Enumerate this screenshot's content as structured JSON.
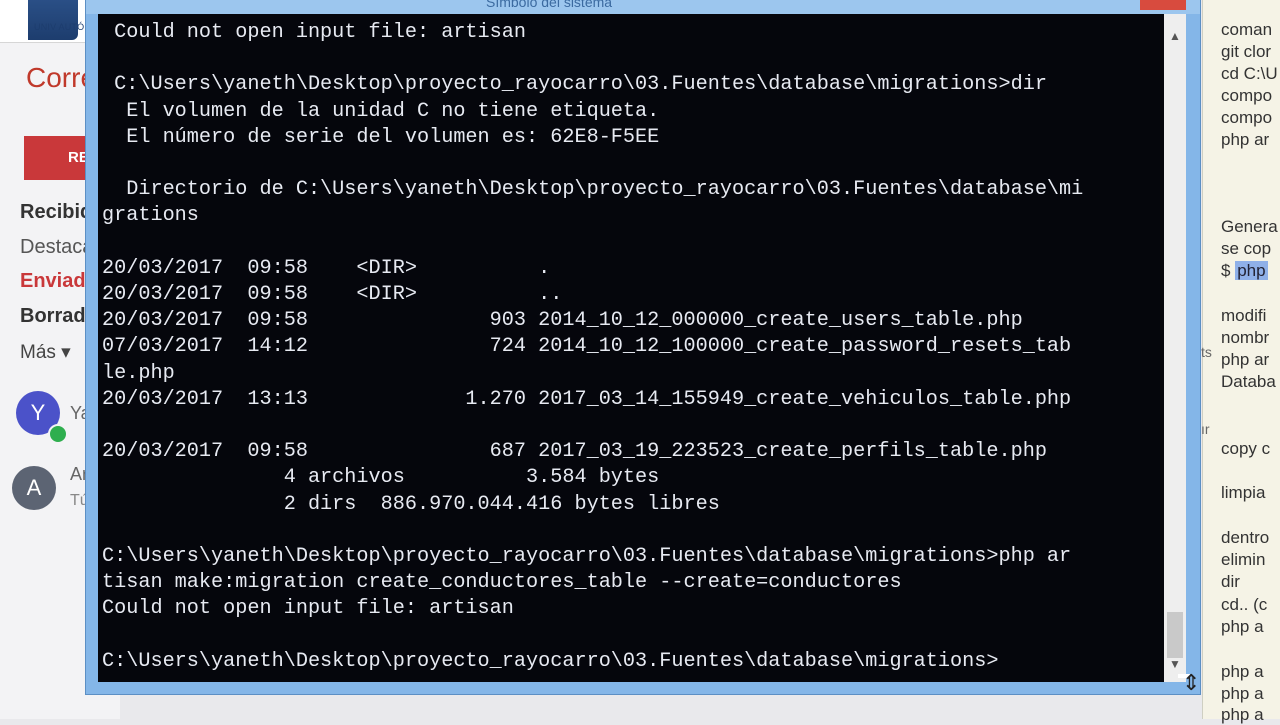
{
  "email_app": {
    "logo_text": "UNIV AUTÓNOMA",
    "title": "Correo",
    "compose": "RED",
    "folders": [
      "Recibid",
      "Destaca",
      "Enviado",
      "Borrado",
      "Más ▾"
    ],
    "contacts": [
      {
        "initial": "Y",
        "name": "Ya",
        "sub": ""
      },
      {
        "initial": "A",
        "name": "Ar",
        "sub": "Tú"
      }
    ]
  },
  "document": {
    "lines": [
      "coman",
      "git clor",
      "cd C:\\U",
      "compo",
      "compo",
      "php ar",
      "Genera",
      "se cop",
      "$ ",
      "php",
      "modifi",
      "nombr",
      "php ar",
      "Databa",
      "copy c",
      "limpia",
      "dentro",
      "elimin",
      "dir",
      "cd.. (c",
      "php a",
      "php a",
      "php a",
      "php a"
    ],
    "side_frags": [
      "ts",
      "ır"
    ]
  },
  "console": {
    "title": "Símbolo del sistema",
    "scroll_up": "▲",
    "scroll_down": "▼",
    "lines": [
      " Could not open input file: artisan",
      "",
      " C:\\Users\\yaneth\\Desktop\\proyecto_rayocarro\\03.Fuentes\\database\\migrations>dir",
      "  El volumen de la unidad C no tiene etiqueta.",
      "  El número de serie del volumen es: 62E8-F5EE",
      "",
      "  Directorio de C:\\Users\\yaneth\\Desktop\\proyecto_rayocarro\\03.Fuentes\\database\\mi",
      "grations",
      "",
      "20/03/2017  09:58    <DIR>          .",
      "20/03/2017  09:58    <DIR>          ..",
      "20/03/2017  09:58               903 2014_10_12_000000_create_users_table.php",
      "07/03/2017  14:12               724 2014_10_12_100000_create_password_resets_tab",
      "le.php",
      "20/03/2017  13:13             1.270 2017_03_14_155949_create_vehiculos_table.php",
      "",
      "20/03/2017  09:58               687 2017_03_19_223523_create_perfils_table.php",
      "               4 archivos          3.584 bytes",
      "               2 dirs  886.970.044.416 bytes libres",
      "",
      "C:\\Users\\yaneth\\Desktop\\proyecto_rayocarro\\03.Fuentes\\database\\migrations>php ar",
      "tisan make:migration create_conductores_table --create=conductores",
      "Could not open input file: artisan",
      "",
      "C:\\Users\\yaneth\\Desktop\\proyecto_rayocarro\\03.Fuentes\\database\\migrations>"
    ]
  }
}
